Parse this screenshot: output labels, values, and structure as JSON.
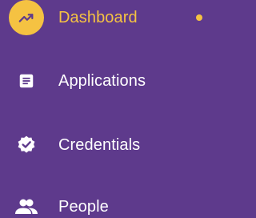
{
  "sidebar": {
    "items": [
      {
        "label": "Dashboard",
        "icon": "trending-up-icon",
        "active": true,
        "indicator": true
      },
      {
        "label": "Applications",
        "icon": "document-icon",
        "active": false
      },
      {
        "label": "Credentials",
        "icon": "verified-badge-icon",
        "active": false
      },
      {
        "label": "People",
        "icon": "people-icon",
        "active": false
      }
    ]
  },
  "colors": {
    "background": "#5e3a8c",
    "accent": "#f5c242",
    "text": "#ffffff"
  }
}
